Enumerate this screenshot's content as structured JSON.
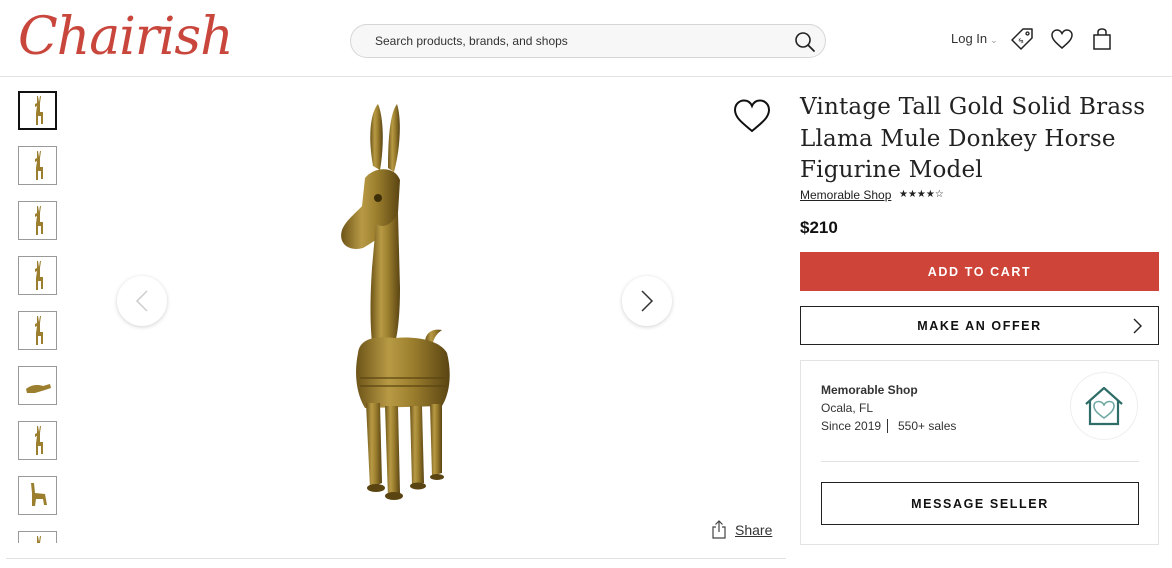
{
  "header": {
    "logo_text": "Chairish",
    "search_placeholder": "Search products, brands, and shops",
    "login_label": "Log In",
    "icons": [
      "search-icon",
      "price-tag-icon",
      "heart-icon",
      "shopping-bag-icon"
    ]
  },
  "colors": {
    "brand": "#c9463d",
    "add_to_cart_bg": "#cf4438",
    "text": "#222222"
  },
  "gallery": {
    "thumbnail_count": 9,
    "active_thumbnail": 1
  },
  "product": {
    "title": "Vintage Tall Gold Solid Brass Llama Mule Donkey Horse Figurine Model",
    "shop_name": "Memorable Shop",
    "rating_stars": "★★★★☆",
    "price": "$210",
    "share_label": "Share"
  },
  "actions": {
    "add_to_cart": "ADD TO CART",
    "make_offer": "MAKE AN OFFER",
    "message_seller": "MESSAGE SELLER"
  },
  "seller": {
    "name": "Memorable Shop",
    "location": "Ocala, FL",
    "since": "Since 2019",
    "sales": "550+ sales"
  }
}
